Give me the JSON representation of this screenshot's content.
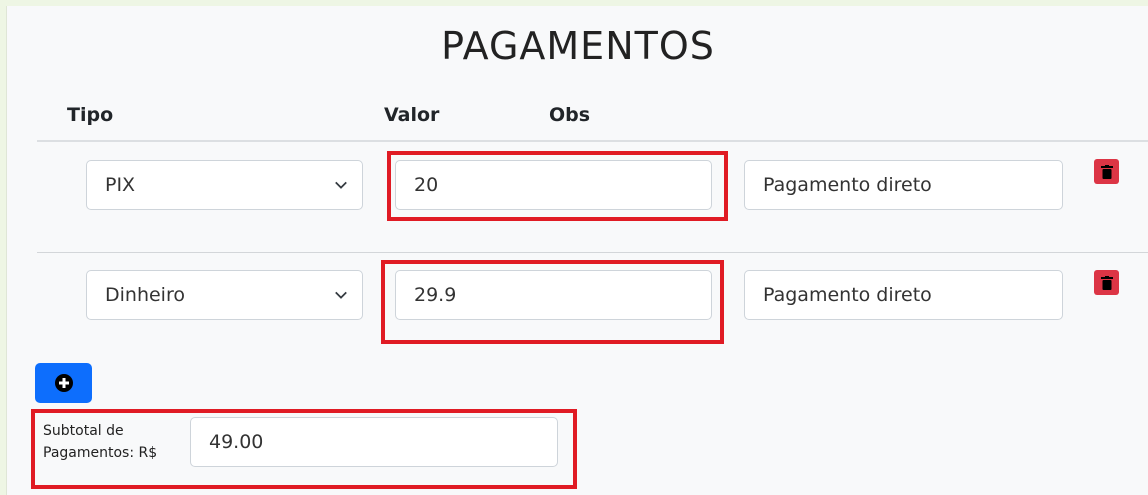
{
  "title": "PAGAMENTOS",
  "headers": {
    "tipo": "Tipo",
    "valor": "Valor",
    "obs": "Obs"
  },
  "rows": [
    {
      "tipo": "PIX",
      "valor": "20",
      "obs": "Pagamento direto"
    },
    {
      "tipo": "Dinheiro",
      "valor": "29.9",
      "obs": "Pagamento direto"
    }
  ],
  "subtotal": {
    "label": "Subtotal de Pagamentos: R$",
    "value": "49.00"
  },
  "icons": {
    "delete": "trash-icon",
    "add": "plus-circle-icon",
    "dropdown": "chevron-down-icon"
  },
  "colors": {
    "highlight": "#e01b24",
    "danger": "#dc3545",
    "primary": "#0d6efd"
  }
}
